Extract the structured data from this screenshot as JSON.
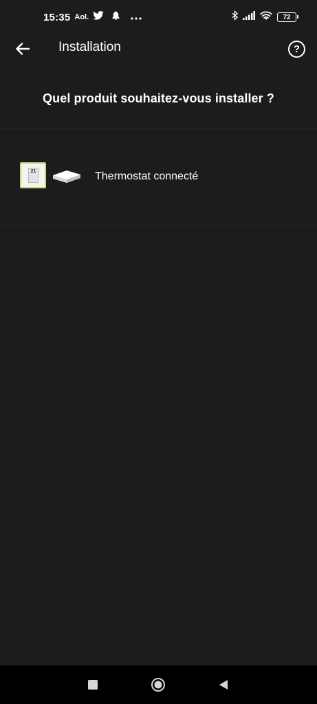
{
  "status_bar": {
    "time": "15:35",
    "carrier": "Aol.",
    "battery": "72",
    "icons": [
      "twitter-icon",
      "notification-bell-icon",
      "more-dots-icon",
      "bluetooth-icon",
      "signal-icon",
      "wifi-icon",
      "battery-icon"
    ]
  },
  "app_bar": {
    "title": "Installation",
    "help_label": "?"
  },
  "question": "Quel produit souhaitez-vous installer ?",
  "products": [
    {
      "label": "Thermostat connecté",
      "display": "21"
    }
  ],
  "nav": {
    "icons": [
      "recents-square-icon",
      "home-circle-icon",
      "back-triangle-icon"
    ]
  },
  "colors": {
    "background": "#1c1c1c",
    "navbar": "#000000",
    "text": "#ffffff",
    "thermostat_border": "#c9d37a"
  }
}
